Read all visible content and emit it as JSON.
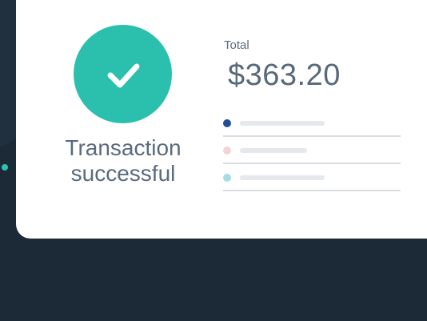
{
  "status": {
    "message_line1": "Transaction",
    "message_line2": "successful",
    "icon": "check-icon",
    "accent_color": "#2bbfae"
  },
  "total": {
    "label": "Total",
    "amount": "$363.20"
  },
  "summary_items": [
    {
      "dot_color": "#1f4e9a"
    },
    {
      "dot_color": "#f3d3d6"
    },
    {
      "dot_color": "#a6dbe8"
    }
  ],
  "theme": {
    "background": "#1b2a36",
    "card": "#ffffff",
    "text": "#5a6b7d"
  }
}
